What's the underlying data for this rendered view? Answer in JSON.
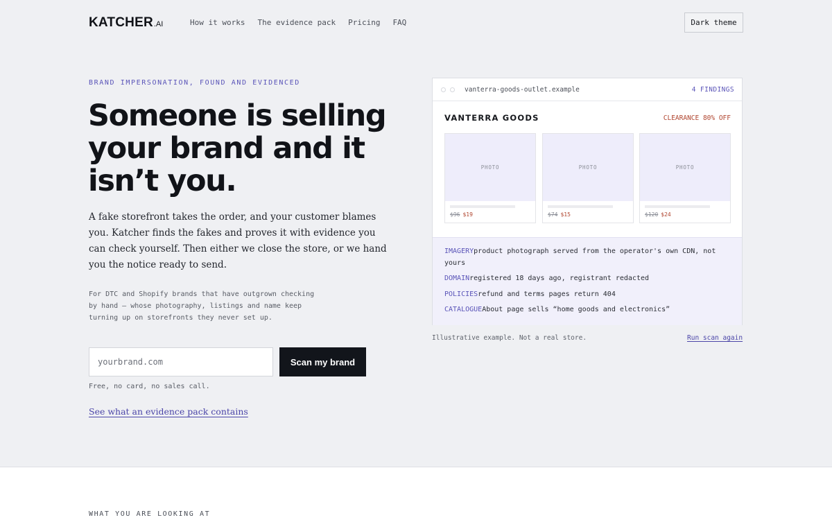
{
  "header": {
    "logo_main": "KATCHER",
    "logo_suffix": ".AI",
    "nav": [
      "How it works",
      "The evidence pack",
      "Pricing",
      "FAQ"
    ],
    "theme_button": "Dark theme"
  },
  "hero": {
    "eyebrow": "BRAND IMPERSONATION, FOUND AND EVIDENCED",
    "headline": "Someone is selling your brand and it isn’t you.",
    "lede": "A fake storefront takes the order, and your customer blames you. Katcher finds the fakes and proves it with evidence you can check yourself. Then either we close the store, or we hand you the notice ready to send.",
    "sub": "For DTC and Shopify brands that have outgrown checking by hand — whose photography, listings and name keep turning up on storefronts they never set up.",
    "input_placeholder": "yourbrand.com",
    "scan_button": "Scan my brand",
    "free_note": "Free, no card, no sales call.",
    "evidence_link": "See what an evidence pack contains"
  },
  "demo": {
    "url": "vanterra-goods-outlet.example",
    "findings_count": "4 FINDINGS",
    "store_name": "VANTERRA GOODS",
    "clearance": "CLEARANCE 80% OFF",
    "products": [
      {
        "photo": "PHOTO",
        "old_price": "$96",
        "new_price": "$19"
      },
      {
        "photo": "PHOTO",
        "old_price": "$74",
        "new_price": "$15"
      },
      {
        "photo": "PHOTO",
        "old_price": "$120",
        "new_price": "$24"
      }
    ],
    "findings": [
      {
        "tag": "IMAGERY",
        "text": "product photograph served from the operator's own CDN, not yours"
      },
      {
        "tag": "DOMAIN",
        "text": "registered 18 days ago, registrant redacted"
      },
      {
        "tag": "POLICIES",
        "text": "refund and terms pages return 404"
      },
      {
        "tag": "CATALOGUE",
        "text": "About page sells “home goods and electronics”"
      }
    ],
    "note": "Illustrative example. Not a real store.",
    "run_again": "Run scan again"
  },
  "next_section": {
    "eyebrow": "WHAT YOU ARE LOOKING AT"
  }
}
